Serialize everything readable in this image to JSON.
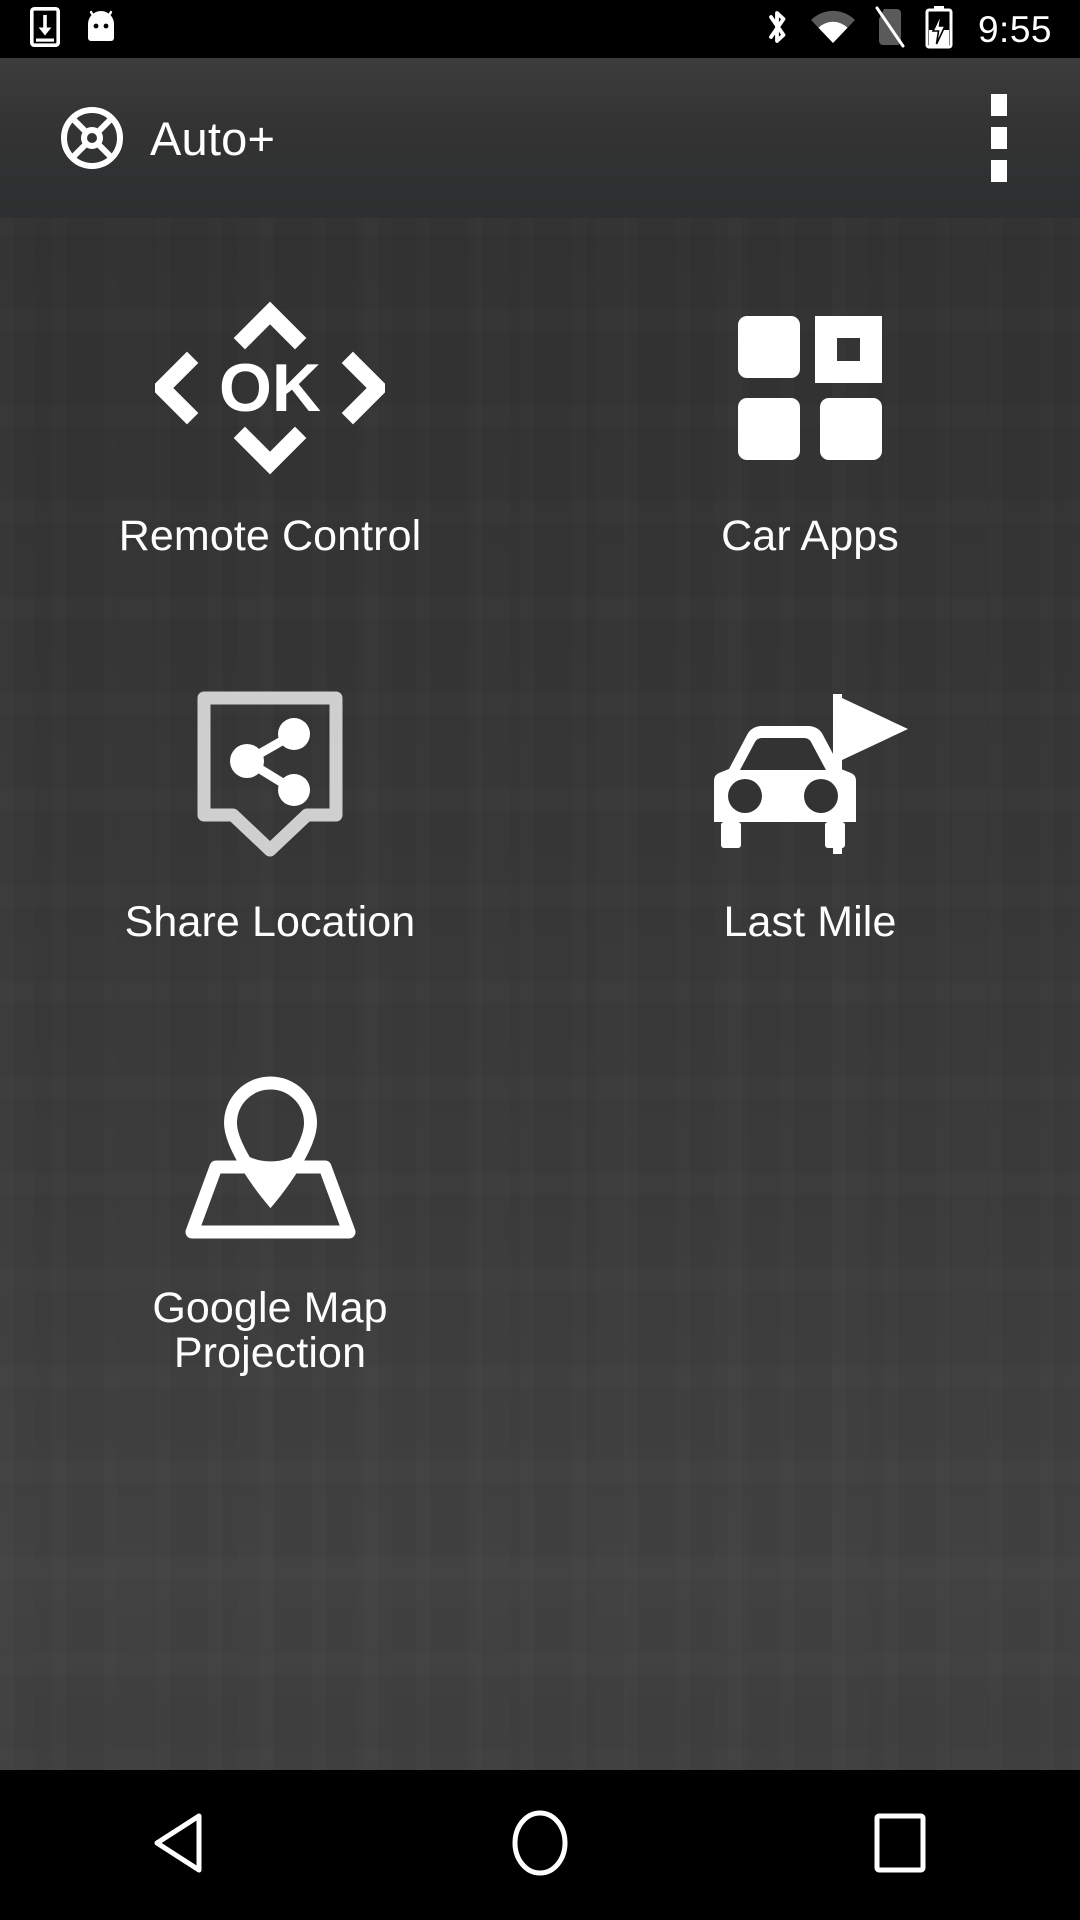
{
  "status_bar": {
    "time": "9:55",
    "left_icons": [
      {
        "name": "download-icon",
        "label": "Download"
      },
      {
        "name": "android-robot-icon",
        "label": "Android System"
      }
    ],
    "right_icons": [
      {
        "name": "bluetooth-icon",
        "label": "Bluetooth"
      },
      {
        "name": "wifi-icon",
        "label": "Wi-Fi"
      },
      {
        "name": "no-sim-icon",
        "label": "No SIM card"
      },
      {
        "name": "battery-charging-icon",
        "label": "Battery charging"
      }
    ]
  },
  "app_bar": {
    "title": "Auto+",
    "logo_icon": "steering-wheel-icon",
    "overflow_icon": "overflow-menu-icon"
  },
  "grid": {
    "items": [
      {
        "label": "Remote Control",
        "icon": "dpad-ok-icon"
      },
      {
        "label": "Car Apps",
        "icon": "apps-grid-icon"
      },
      {
        "label": "Share Location",
        "icon": "share-location-icon"
      },
      {
        "label": "Last Mile",
        "icon": "car-flag-icon"
      },
      {
        "label": "Google Map\nProjection",
        "icon": "map-pin-projection-icon"
      }
    ]
  },
  "nav_bar": {
    "back_label": "Back",
    "home_label": "Home",
    "recents_label": "Recent apps"
  },
  "colors": {
    "status_bar_bg": "#000000",
    "app_bar_bg": "#333333",
    "content_bg": "#3a3a3a",
    "nav_bar_bg": "#000000",
    "icon_fill": "#ffffff",
    "label_text": "#fdfdfd",
    "share_outline": "#cfcfcf"
  }
}
